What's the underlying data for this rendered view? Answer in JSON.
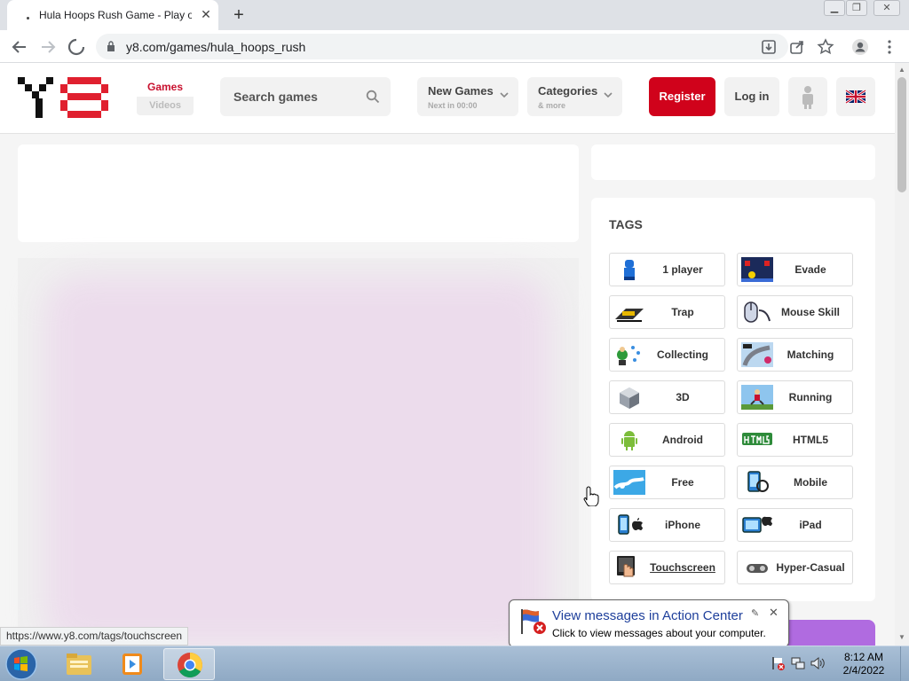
{
  "browser": {
    "tab_title": "Hula Hoops Rush Game - Play o",
    "url": "y8.com/games/hula_hoops_rush",
    "status_url": "https://www.y8.com/tags/touchscreen"
  },
  "header": {
    "games_label": "Games",
    "videos_label": "Videos",
    "search_placeholder": "Search games",
    "new_games_label": "New Games",
    "new_games_sub": "Next in 00:00",
    "categories_label": "Categories",
    "categories_sub": "& more",
    "register_label": "Register",
    "login_label": "Log in"
  },
  "tags": {
    "title": "TAGS",
    "items": [
      {
        "label": "1 player",
        "icon": "player-icon"
      },
      {
        "label": "Evade",
        "icon": "evade-icon"
      },
      {
        "label": "Trap",
        "icon": "trap-icon"
      },
      {
        "label": "Mouse Skill",
        "icon": "mouse-skill-icon"
      },
      {
        "label": "Collecting",
        "icon": "collecting-icon"
      },
      {
        "label": "Matching",
        "icon": "matching-icon"
      },
      {
        "label": "3D",
        "icon": "cube-3d-icon"
      },
      {
        "label": "Running",
        "icon": "running-icon"
      },
      {
        "label": "Android",
        "icon": "android-icon"
      },
      {
        "label": "HTML5",
        "icon": "html5-icon"
      },
      {
        "label": "Free",
        "icon": "free-icon"
      },
      {
        "label": "Mobile",
        "icon": "mobile-icon"
      },
      {
        "label": "iPhone",
        "icon": "iphone-icon"
      },
      {
        "label": "iPad",
        "icon": "ipad-icon"
      },
      {
        "label": "Touchscreen",
        "icon": "touchscreen-icon"
      },
      {
        "label": "Hyper-Casual",
        "icon": "hyper-casual-icon"
      }
    ]
  },
  "notification": {
    "title": "View messages in Action Center",
    "text": "Click to view messages about your computer."
  },
  "taskbar": {
    "time": "8:12 AM",
    "date": "2/4/2022"
  },
  "colors": {
    "brand_red": "#d0021b",
    "accent_purple": "#b06be0"
  }
}
